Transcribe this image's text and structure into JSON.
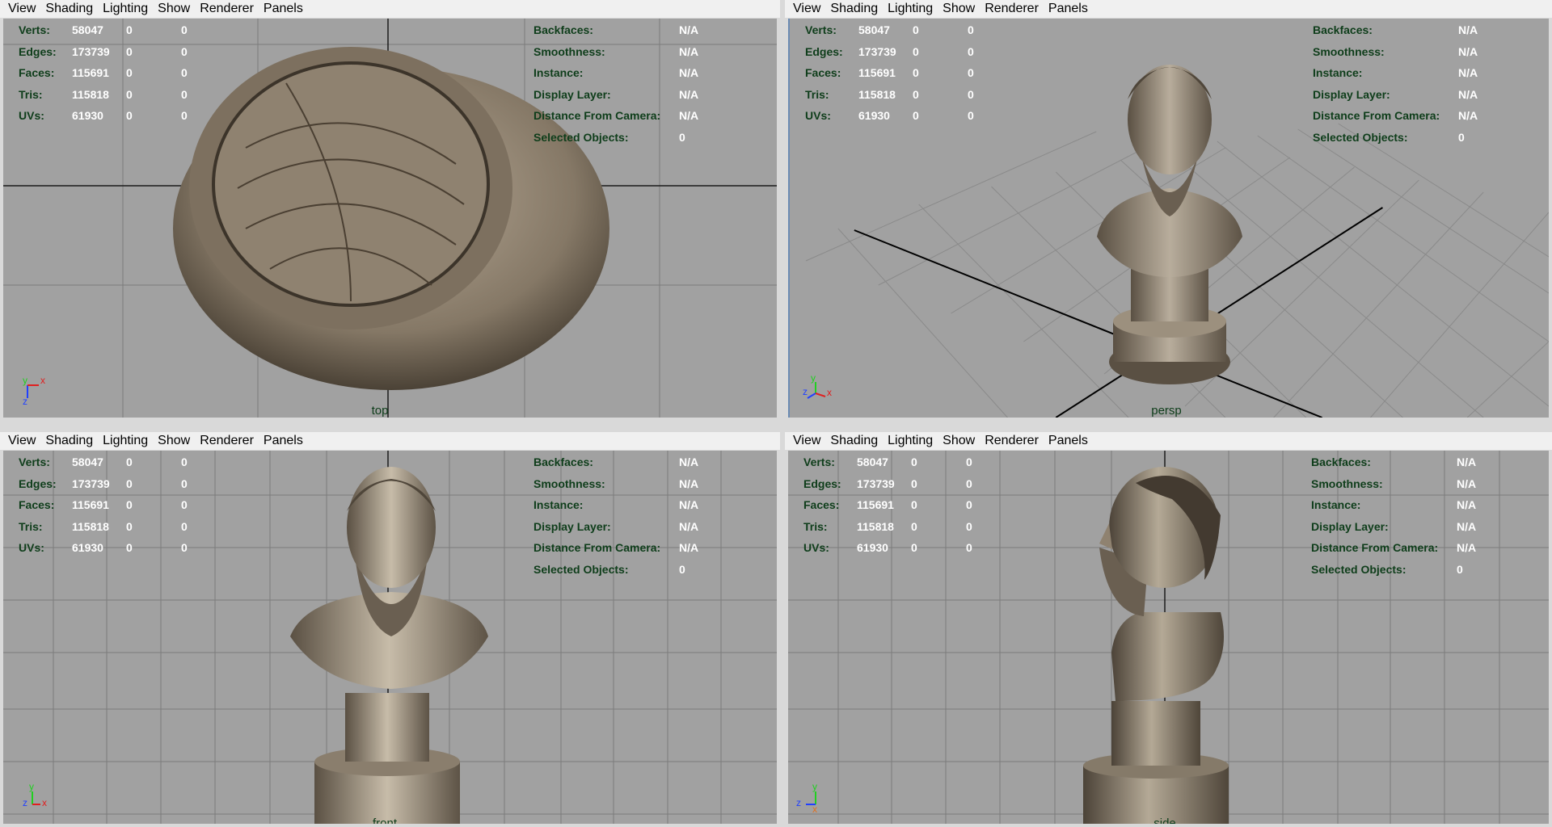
{
  "menu": [
    "View",
    "Shading",
    "Lighting",
    "Show",
    "Renderer",
    "Panels"
  ],
  "hud": {
    "left_rows": [
      {
        "label": "Verts:",
        "v1": "58047",
        "v2": "0",
        "v3": "0"
      },
      {
        "label": "Edges:",
        "v1": "173739",
        "v2": "0",
        "v3": "0"
      },
      {
        "label": "Faces:",
        "v1": "115691",
        "v2": "0",
        "v3": "0"
      },
      {
        "label": "Tris:",
        "v1": "115818",
        "v2": "0",
        "v3": "0"
      },
      {
        "label": "UVs:",
        "v1": "61930",
        "v2": "0",
        "v3": "0"
      }
    ],
    "right_rows": [
      {
        "label": "Backfaces:",
        "value": "N/A"
      },
      {
        "label": "Smoothness:",
        "value": "N/A"
      },
      {
        "label": "Instance:",
        "value": "N/A"
      },
      {
        "label": "Display Layer:",
        "value": "N/A"
      },
      {
        "label": "Distance From Camera:",
        "value": "N/A"
      },
      {
        "label": "Selected Objects:",
        "value": "0"
      }
    ]
  },
  "panels": [
    {
      "camera": "top",
      "axes": [
        "y",
        "x",
        "z"
      ]
    },
    {
      "camera": "persp",
      "axes": [
        "y",
        "z",
        "x"
      ]
    },
    {
      "camera": "front",
      "axes": [
        "y",
        "z",
        "x"
      ]
    },
    {
      "camera": "side",
      "axes": [
        "y",
        "z",
        "x"
      ]
    }
  ],
  "colors": {
    "viewport_bg": "#a1a1a1",
    "hud_label": "#0e3d1a",
    "hud_value": "#ffffff",
    "axis_x": "#e02020",
    "axis_y": "#20d020",
    "axis_z": "#2040ff"
  }
}
